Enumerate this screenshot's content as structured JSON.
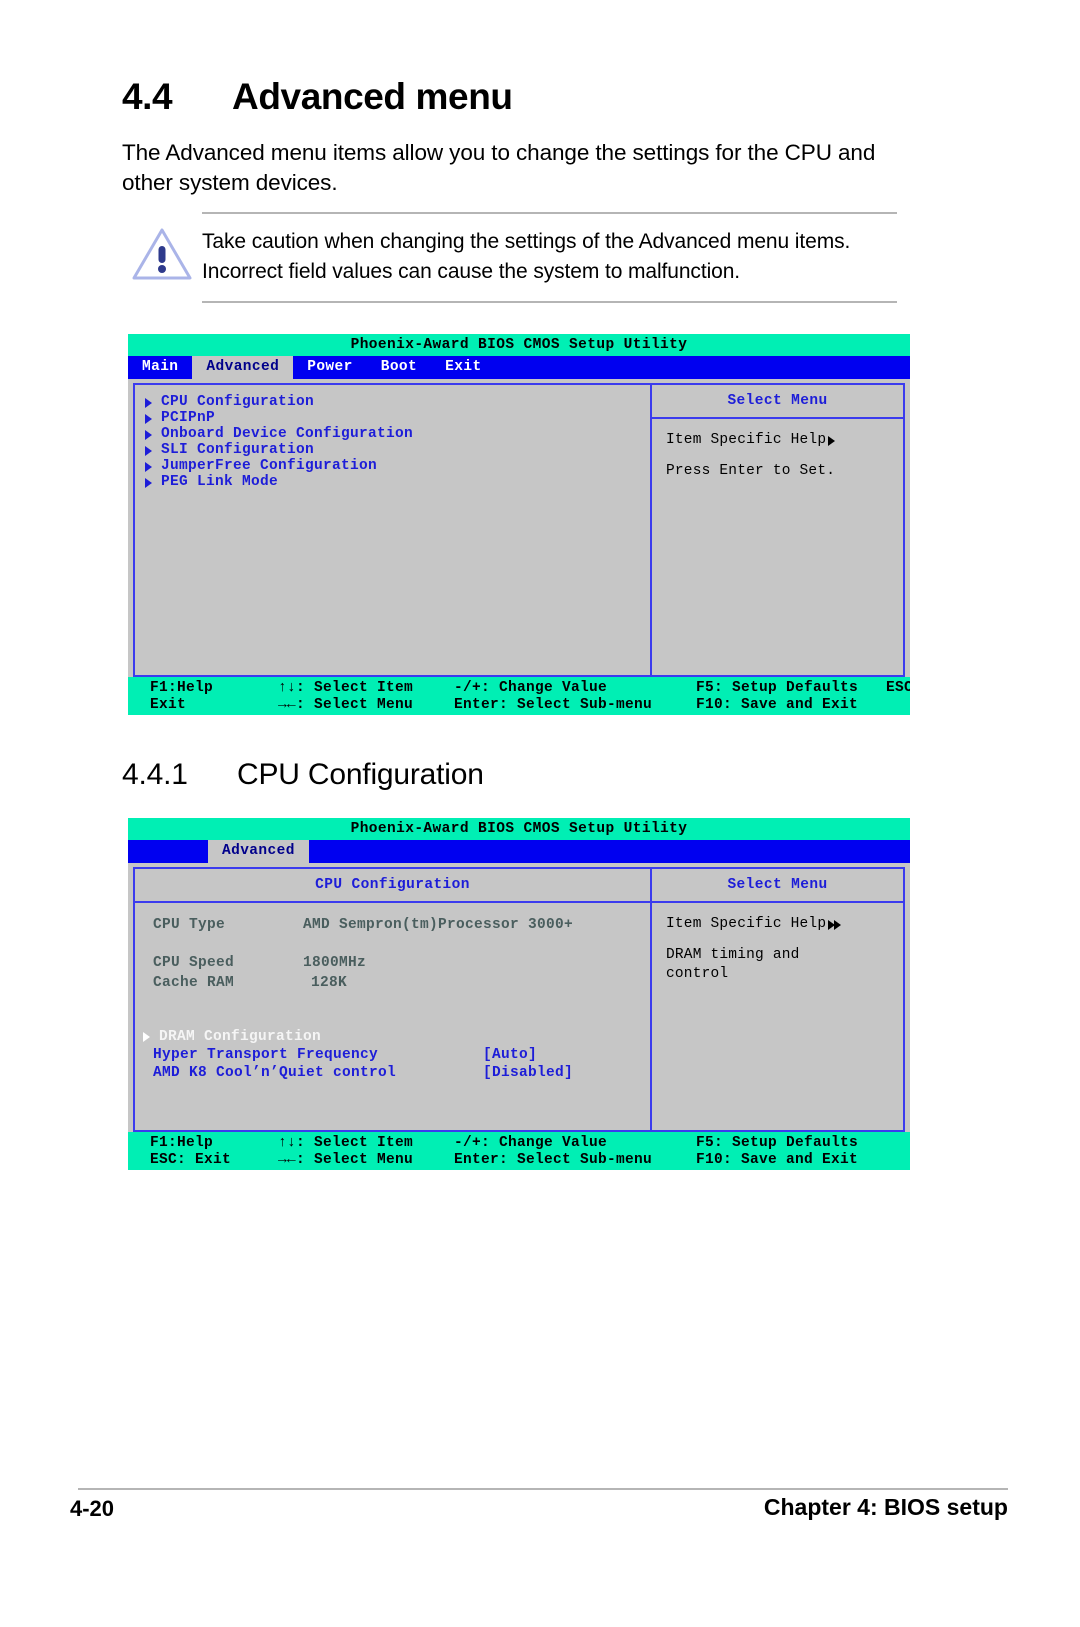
{
  "doc": {
    "section_number": "4.4",
    "section_title": "Advanced menu",
    "intro": "The Advanced menu items allow you to change the settings for the CPU and other system devices.",
    "caution": "Take caution when changing the settings of the Advanced menu items. Incorrect field values can cause the system to malfunction.",
    "caution_icon": "warning-triangle-icon",
    "subsection_number": "4.4.1",
    "subsection_title": "CPU Configuration",
    "page_number": "4-20",
    "chapter_label": "Chapter 4: BIOS setup"
  },
  "bios_common": {
    "title": "Phoenix-Award BIOS CMOS Setup Utility",
    "select_menu": "Select Menu",
    "item_specific_help": "Item Specific Help",
    "footer": {
      "f1": "F1:Help",
      "select_item": "↑↓: Select Item",
      "change_value": "-/+: Change Value",
      "f5": "F5: Setup Defaults",
      "esc": "ESC:",
      "exit": "Exit",
      "select_menu": "→←: Select Menu",
      "select_submenu": "Enter: Select Sub-menu",
      "f10": "F10: Save and Exit",
      "esc_exit": "ESC: Exit"
    }
  },
  "screen1": {
    "tabs": [
      {
        "label": "Main",
        "active": false
      },
      {
        "label": "Advanced",
        "active": true
      },
      {
        "label": "Power",
        "active": false
      },
      {
        "label": "Boot",
        "active": false
      },
      {
        "label": "Exit",
        "active": false
      }
    ],
    "menu_items": [
      "CPU Configuration",
      "PCIPnP",
      "Onboard Device Configuration",
      "SLI Configuration",
      "JumperFree Configuration",
      "PEG Link Mode"
    ],
    "help_text": "Press Enter to Set."
  },
  "screen2": {
    "tabs": [
      {
        "label": "",
        "active": false
      },
      {
        "label": "Advanced",
        "active": true
      }
    ],
    "panel_title": "CPU Configuration",
    "rows": [
      {
        "label": "CPU Type",
        "value": "AMD Sempron(tm)Processor 3000+",
        "style": "gray"
      },
      {
        "label": "CPU Speed",
        "value": "1800MHz",
        "style": "gray"
      },
      {
        "label": "Cache RAM",
        "value": "128K",
        "style": "gray"
      }
    ],
    "dram_item": "DRAM Configuration",
    "settings": [
      {
        "label": "Hyper Transport Frequency",
        "value": "[Auto]"
      },
      {
        "label": "AMD K8 Cool’n’Quiet control",
        "value": "[Disabled]"
      }
    ],
    "help_line1": "DRAM timing and",
    "help_line2": "control"
  }
}
